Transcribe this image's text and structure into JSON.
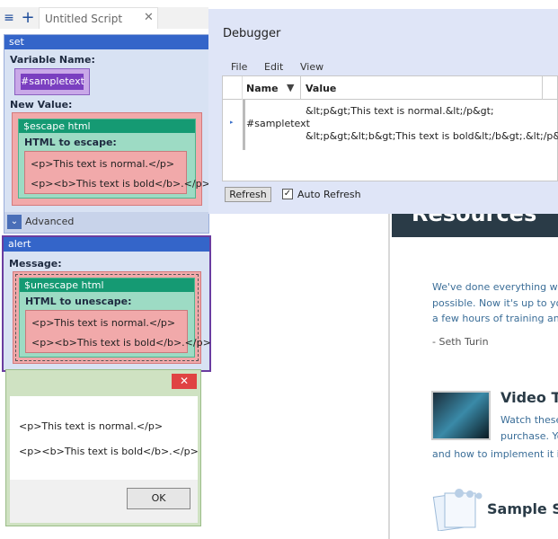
{
  "tab_bar": {
    "tab_title": "Untitled Script",
    "menu_icon": "≡",
    "add_icon": "+",
    "close_icon": "✕"
  },
  "set_block": {
    "header": "set",
    "variable_label": "Variable Name:",
    "variable_value": "#sampletext",
    "new_value_label": "New Value:",
    "inner_header": "$escape html",
    "inner_label": "HTML to escape:",
    "lines": [
      "<p>This text is normal.</p>",
      "<p><b>This text is bold</b>.</p>"
    ],
    "advanced_label": "Advanced",
    "advanced_icon": "⌄"
  },
  "alert_block": {
    "header": "alert",
    "message_label": "Message:",
    "inner_header": "$unescape html",
    "inner_label": "HTML to unescape:",
    "lines": [
      "<p>This text is normal.</p>",
      "<p><b>This text is bold</b>.</p>"
    ]
  },
  "dialog": {
    "close_icon": "✕",
    "lines": [
      "<p>This text is normal.</p>",
      "<p><b>This text is bold</b>.</p>"
    ],
    "ok_label": "OK"
  },
  "debugger": {
    "title": "Debugger",
    "menu": [
      "File",
      "Edit",
      "View"
    ],
    "col_name": "Name",
    "col_value": "Value",
    "filter_icon": "▼",
    "row_arrow": "▸",
    "row_name": "#sampletext",
    "row_value_lines": [
      "&lt;p&gt;This text is normal.&lt;/p&gt;",
      "&lt;p&gt;&lt;b&gt;This text is bold&lt;/b&gt;.&lt;/p&gt;"
    ],
    "refresh_label": "Refresh",
    "auto_refresh_label": "Auto Refresh",
    "auto_refresh_checked": "✓"
  },
  "webpage": {
    "banner": "Resources",
    "intro_lines": [
      "We've done everything w",
      "possible. Now it's up to yo",
      "a few hours of training and"
    ],
    "author": "- Seth Turin",
    "video_title": "Video Tr",
    "video_lines": [
      "Watch these",
      "purchase. Yo"
    ],
    "video_line3": "and how to implement it in",
    "samples_title": "Sample So"
  }
}
